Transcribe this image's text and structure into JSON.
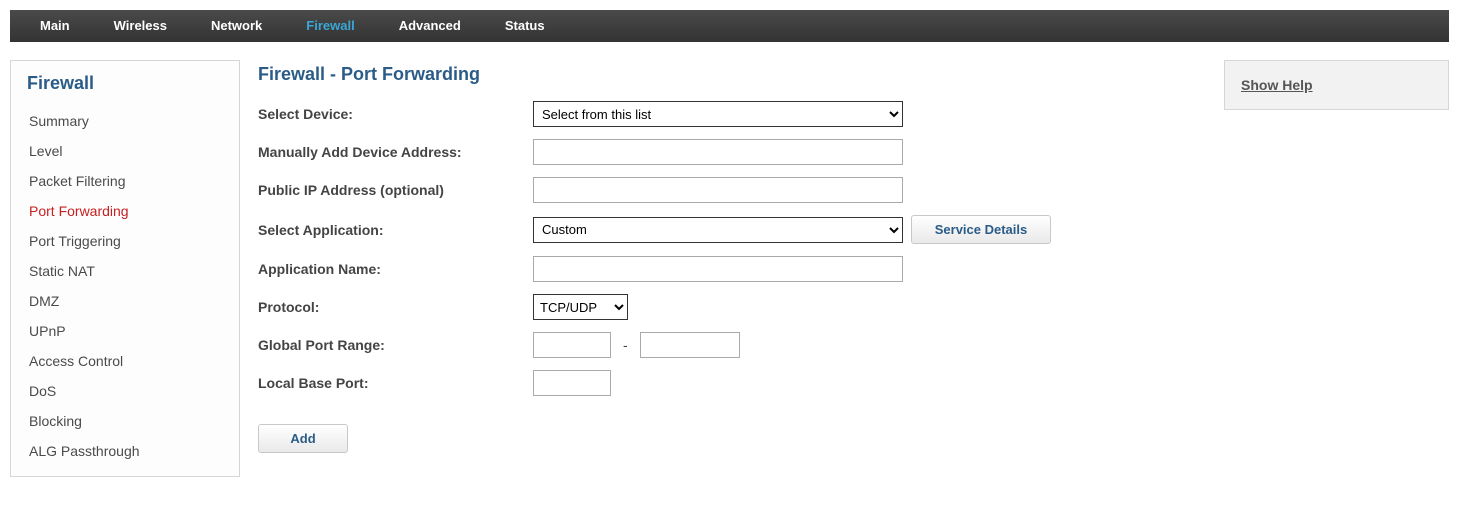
{
  "topnav": {
    "items": [
      {
        "label": "Main",
        "active": false
      },
      {
        "label": "Wireless",
        "active": false
      },
      {
        "label": "Network",
        "active": false
      },
      {
        "label": "Firewall",
        "active": true
      },
      {
        "label": "Advanced",
        "active": false
      },
      {
        "label": "Status",
        "active": false
      }
    ]
  },
  "sidebar": {
    "title": "Firewall",
    "items": [
      {
        "label": "Summary",
        "active": false
      },
      {
        "label": "Level",
        "active": false
      },
      {
        "label": "Packet Filtering",
        "active": false
      },
      {
        "label": "Port Forwarding",
        "active": true
      },
      {
        "label": "Port Triggering",
        "active": false
      },
      {
        "label": "Static NAT",
        "active": false
      },
      {
        "label": "DMZ",
        "active": false
      },
      {
        "label": "UPnP",
        "active": false
      },
      {
        "label": "Access Control",
        "active": false
      },
      {
        "label": "DoS",
        "active": false
      },
      {
        "label": "Blocking",
        "active": false
      },
      {
        "label": "ALG Passthrough",
        "active": false
      }
    ]
  },
  "main": {
    "title": "Firewall - Port Forwarding",
    "labels": {
      "select_device": "Select Device:",
      "manual_address": "Manually Add Device Address:",
      "public_ip": "Public IP Address (optional)",
      "select_application": "Select Application:",
      "application_name": "Application Name:",
      "protocol": "Protocol:",
      "global_port_range": "Global Port Range:",
      "local_base_port": "Local Base Port:"
    },
    "fields": {
      "select_device_option": "Select from this list",
      "manual_address_value": "",
      "public_ip_value": "",
      "select_application_option": "Custom",
      "application_name_value": "",
      "protocol_option": "TCP/UDP",
      "global_port_start": "",
      "global_port_end": "",
      "local_base_port_value": "",
      "port_dash": "-"
    },
    "buttons": {
      "service_details": "Service Details",
      "add": "Add"
    }
  },
  "help": {
    "link": "Show Help"
  }
}
